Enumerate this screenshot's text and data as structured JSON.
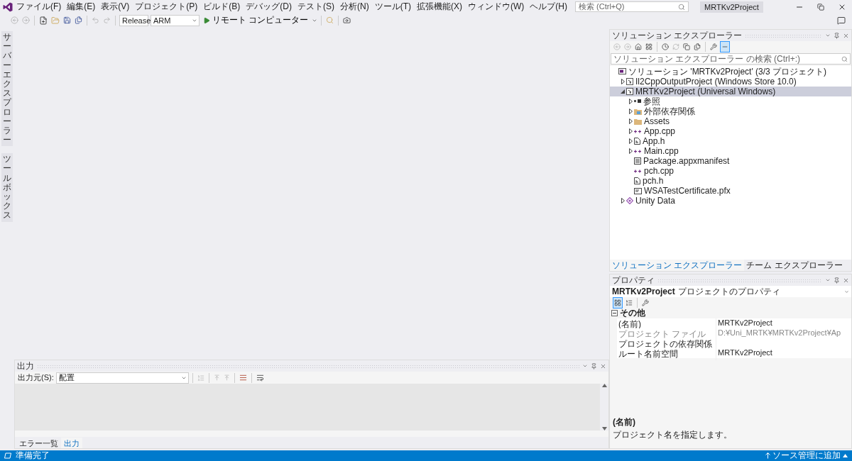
{
  "title_bar": {
    "menus": [
      "ファイル(F)",
      "編集(E)",
      "表示(V)",
      "プロジェクト(P)",
      "ビルド(B)",
      "デバッグ(D)",
      "テスト(S)",
      "分析(N)",
      "ツール(T)",
      "拡張機能(X)",
      "ウィンドウ(W)",
      "ヘルプ(H)"
    ],
    "search": {
      "placeholder": "検索 (Ctrl+Q)"
    },
    "solution_name": "MRTKv2Project"
  },
  "toolbar": {
    "configuration": "Release",
    "platform": "ARM",
    "run_target": "リモート コンピューター"
  },
  "side_tabs": [
    "サーバーエクスプローラー",
    "ツールボックス"
  ],
  "output_panel": {
    "title": "出力",
    "source_label": "出力元(S):",
    "source_value": "配置",
    "tabs": [
      {
        "label": "エラー一覧",
        "selected": false
      },
      {
        "label": "出力",
        "selected": true
      }
    ]
  },
  "solution_explorer": {
    "title": "ソリューション エクスプローラー",
    "search": {
      "placeholder": "ソリューション エクスプローラー の検索 (Ctrl+:)"
    },
    "tree": [
      {
        "label": "ソリューション 'MRTKv2Project' (3/3 プロジェクト)",
        "kind": "solution",
        "selected": false,
        "children": [
          {
            "label": "Il2CppOutputProject (Windows Store 10.0)",
            "kind": "project",
            "expanded": false,
            "selected": false
          },
          {
            "label": "MRTKv2Project (Universal Windows)",
            "kind": "project",
            "expanded": true,
            "selected": true,
            "children": [
              {
                "label": "参照",
                "kind": "references",
                "expanded": false,
                "selected": false
              },
              {
                "label": "外部依存関係",
                "kind": "external",
                "expanded": false,
                "selected": false
              },
              {
                "label": "Assets",
                "kind": "folder",
                "expanded": false,
                "selected": false
              },
              {
                "label": "App.cpp",
                "kind": "cpp",
                "expanded": false,
                "selected": false
              },
              {
                "label": "App.h",
                "kind": "header",
                "expanded": false,
                "selected": false
              },
              {
                "label": "Main.cpp",
                "kind": "cpp",
                "expanded": false,
                "selected": false
              },
              {
                "label": "Package.appxmanifest",
                "kind": "manifest",
                "selected": false
              },
              {
                "label": "pch.cpp",
                "kind": "cpp",
                "selected": false
              },
              {
                "label": "pch.h",
                "kind": "header",
                "selected": false
              },
              {
                "label": "WSATestCertificate.pfx",
                "kind": "certificate",
                "selected": false
              }
            ]
          },
          {
            "label": "Unity Data",
            "kind": "unity",
            "expanded": false,
            "selected": false
          }
        ]
      }
    ],
    "tabs": [
      {
        "label": "ソリューション エクスプローラー",
        "selected": true
      },
      {
        "label": "チーム エクスプローラー",
        "selected": false
      }
    ]
  },
  "properties": {
    "title": "プロパティ",
    "object_name": "MRTKv2Project",
    "object_type": "プロジェクトのプロパティ",
    "category": "その他",
    "rows": [
      {
        "name": "(名前)",
        "value": "MRTKv2Project",
        "disabled": false
      },
      {
        "name": "プロジェクト ファイル",
        "value": "D:¥Uni_MRTK¥MRTKv2Project¥Ap",
        "disabled": true
      },
      {
        "name": "プロジェクトの依存関係",
        "disabled": false
      },
      {
        "name": "ルート名前空間",
        "value": "MRTKv2Project",
        "disabled": false
      }
    ],
    "description_title": "(名前)",
    "description": "プロジェクト名を指定します。"
  },
  "status_bar": {
    "message": "準備完了",
    "source_control": "ソース管理に追加"
  }
}
